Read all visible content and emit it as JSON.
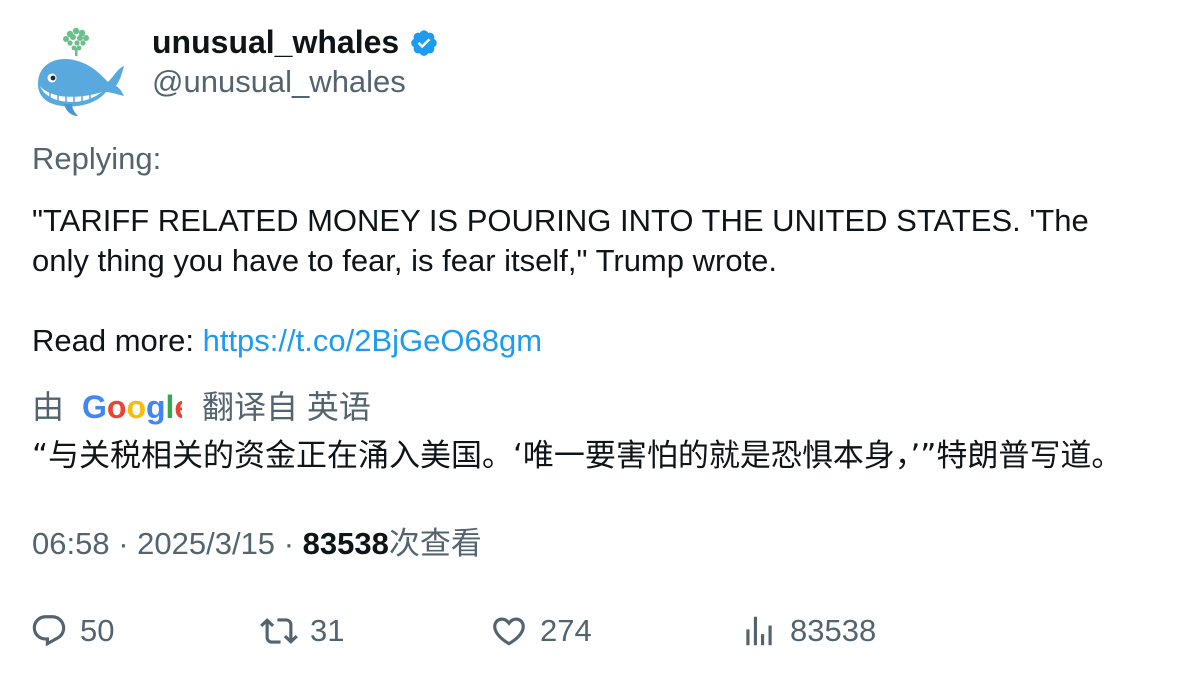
{
  "user": {
    "display_name": "unusual_whales",
    "handle": "@unusual_whales",
    "verified": true
  },
  "replying_label": "Replying:",
  "tweet": {
    "text": "\"TARIFF RELATED MONEY IS POURING INTO THE UNITED STATES. 'The only thing you have to fear, is fear itself,\" Trump wrote.",
    "read_more_label": "Read more:",
    "link": "https://t.co/2BjGeO68gm"
  },
  "translation": {
    "by_label": "由",
    "provider_logo": "Google",
    "from_label": "翻译自 英语",
    "text": "“与关税相关的资金正在涌入美国。‘唯一要害怕的就是恐惧本身，’”特朗普写道。"
  },
  "meta": {
    "time": "06:58",
    "date": "2025/3/15",
    "views_count": "83538",
    "views_label": "次查看"
  },
  "actions": {
    "replies": "50",
    "retweets": "31",
    "likes": "274",
    "views": "83538"
  },
  "colors": {
    "link": "#1d9bf0",
    "secondary_text": "#536471",
    "verified": "#1d9bf0"
  }
}
